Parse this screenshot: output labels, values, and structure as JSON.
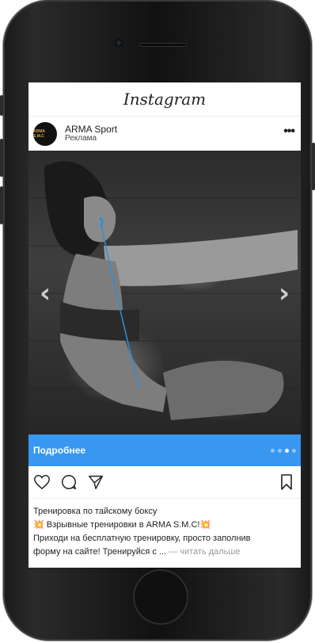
{
  "app": {
    "title": "Instagram"
  },
  "post": {
    "account_name": "ARMA Sport",
    "sponsored_label": "Реклама",
    "avatar_text": "ARMA S.M.C",
    "more_label": "•••",
    "cta_label": "Подробнее",
    "carousel": {
      "total": 4,
      "active_index": 2
    },
    "caption": {
      "line1": "Тренировка по тайскому боксу",
      "line2_emoji": "💥",
      "line2_text": " Взрывные тренировки в ARMA S.M.C!",
      "line2_emoji_end": "💥",
      "line3": "Приходи на бесплатную тренировку, просто заполнив",
      "line4": "форму на сайте! Тренируйся с ...",
      "read_more": " — читать дальше"
    },
    "icons": {
      "like": "heart-icon",
      "comment": "comment-icon",
      "share": "send-icon",
      "save": "bookmark-icon",
      "prev": "chevron-left-icon",
      "next": "chevron-right-icon"
    }
  },
  "colors": {
    "cta": "#3897f0",
    "text": "#222222",
    "muted": "#999999"
  }
}
